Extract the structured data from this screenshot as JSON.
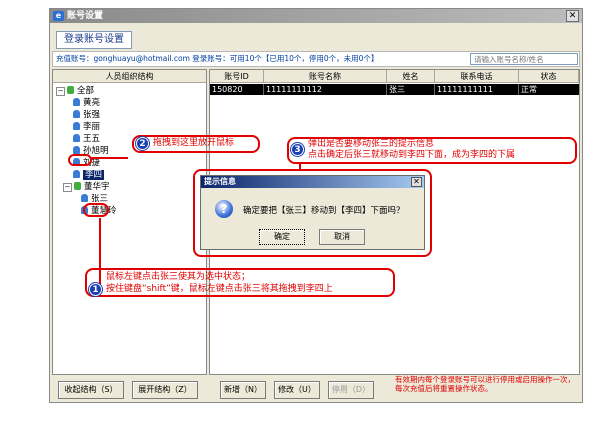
{
  "window": {
    "title": "账号设置",
    "tab_label": "登录账号设置",
    "info_text": "充值账号：gonghuayu@hotmail.com 登录账号：可用10个【已用10个，停用0个，未用0个】",
    "search_placeholder": "请输入账号名称/姓名"
  },
  "tree": {
    "header": "人员组织结构",
    "root": "全部",
    "people": [
      "黄亮",
      "张强",
      "李丽",
      "王五",
      "孙旭明",
      "刘捷",
      "李四"
    ],
    "subdept": "董华宇",
    "subpeople": [
      "张三",
      "董慧玲"
    ]
  },
  "grid": {
    "columns": [
      "账号ID",
      "账号名称",
      "姓名",
      "联系电话",
      "状态"
    ],
    "rows": [
      {
        "id": "150820",
        "name": "11111111112",
        "person": "张三",
        "phone": "11111111111",
        "status": "正常"
      }
    ]
  },
  "buttons": {
    "collapse": "收起结构（S）",
    "expand": "展开结构（Z）",
    "add": "新增（N）",
    "edit": "修改（U）",
    "disable": "停用（D）"
  },
  "note": "有效期内每个登录账号可以进行停用或启用操作一次，每次充值后将重置操作状态。",
  "dialog": {
    "title": "提示信息",
    "message": "确定要把【张三】移动到【李四】下面吗？",
    "ok": "确定",
    "cancel": "取消"
  },
  "annotations": {
    "step1_badge": "1",
    "step1_line1": "鼠标左键点击张三使其为选中状态；",
    "step1_line2": "按住键盘“shift”键，鼠标左键点击张三将其拖拽到李四上",
    "step2_badge": "2",
    "step2_text": "拖拽到这里放开鼠标",
    "step3_badge": "3",
    "step3_line1": "弹出是否要移动张三的提示信息",
    "step3_line2": "点击确定后张三就移动到李四下面，成为李四的下属"
  },
  "colors": {
    "annotation": "#e00000",
    "selection": "#0a246a",
    "badge": "#1a3fb0"
  }
}
